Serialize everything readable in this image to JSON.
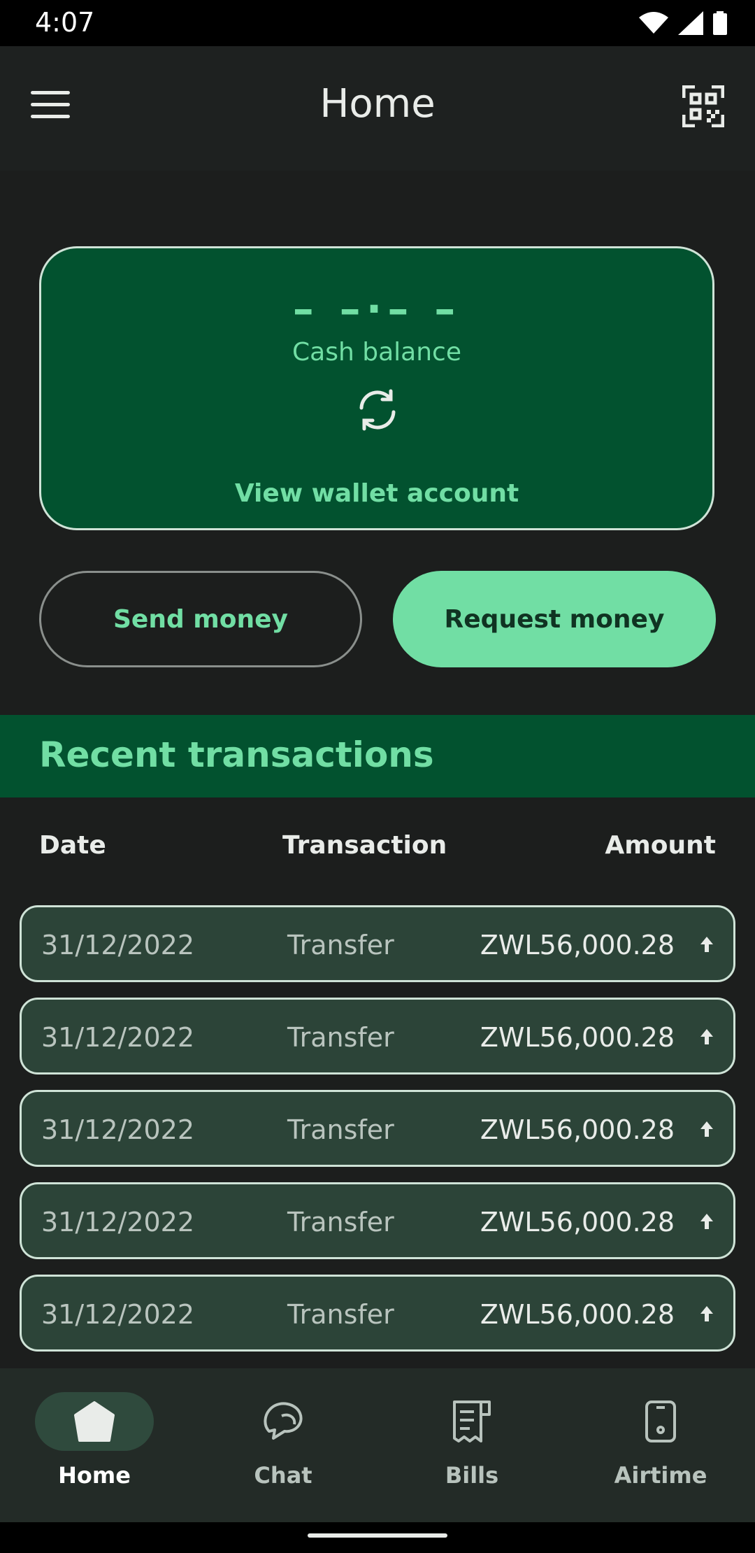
{
  "status_bar": {
    "time": "4:07",
    "icons": [
      "wifi-icon",
      "signal-icon",
      "battery-icon"
    ]
  },
  "app_bar": {
    "title": "Home",
    "menu_icon": "menu-icon",
    "qr_icon": "qr-code-icon"
  },
  "balance_card": {
    "balance_placeholder": "– –·– –",
    "label": "Cash balance",
    "refresh_icon": "refresh-icon",
    "view_link": "View wallet account"
  },
  "actions": {
    "send_label": "Send money",
    "request_label": "Request money"
  },
  "recent": {
    "title": "Recent transactions"
  },
  "columns": {
    "date": "Date",
    "transaction": "Transaction",
    "amount": "Amount"
  },
  "transactions": [
    {
      "date": "31/12/2022",
      "type": "Transfer",
      "amount": "ZWL56,000.28",
      "direction": "up-arrow-icon"
    },
    {
      "date": "31/12/2022",
      "type": "Transfer",
      "amount": "ZWL56,000.28",
      "direction": "up-arrow-icon"
    },
    {
      "date": "31/12/2022",
      "type": "Transfer",
      "amount": "ZWL56,000.28",
      "direction": "up-arrow-icon"
    },
    {
      "date": "31/12/2022",
      "type": "Transfer",
      "amount": "ZWL56,000.28",
      "direction": "up-arrow-icon"
    },
    {
      "date": "31/12/2022",
      "type": "Transfer",
      "amount": "ZWL56,000.28",
      "direction": "up-arrow-icon"
    }
  ],
  "bottom_nav": {
    "items": [
      {
        "label": "Home",
        "icon": "home-icon",
        "active": true
      },
      {
        "label": "Chat",
        "icon": "chat-icon",
        "active": false
      },
      {
        "label": "Bills",
        "icon": "bills-icon",
        "active": false
      },
      {
        "label": "Airtime",
        "icon": "phone-icon",
        "active": false
      }
    ]
  },
  "colors": {
    "background": "#1c1e1d",
    "accent": "#71dea4",
    "card_green": "#02522f",
    "row_green": "#2c4438"
  }
}
